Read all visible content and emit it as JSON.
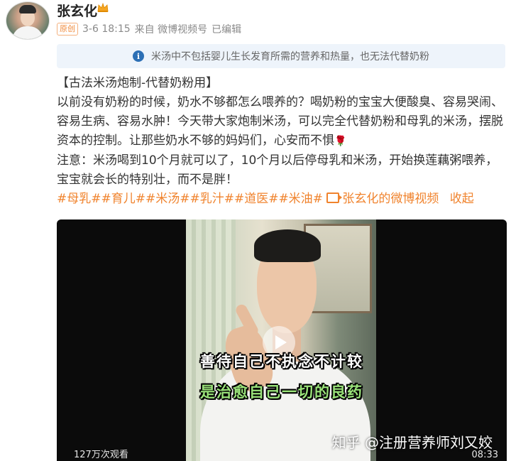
{
  "author": {
    "name": "张玄化",
    "crown_icon": "crown-icon"
  },
  "meta": {
    "badge": "原创",
    "date": "3-6 18:15",
    "source": "来自 微博视频号",
    "edited": "已编辑"
  },
  "notice": {
    "icon": "info-icon",
    "text": "米汤中不包括婴儿生长发育所需的营养和热量，也无法代替奶粉"
  },
  "post": {
    "title": "【古法米汤炮制-代替奶粉用】",
    "paragraph1": "以前没有奶粉的时候，奶水不够都怎么喂养的？喝奶粉的宝宝大便酸臭、容易哭闹、容易生病、容易水肿！今天带大家炮制米汤，可以完全代替奶粉和母乳的米汤，摆脱资本的控制。让那些奶水不够的妈妈们，心安而不惧",
    "rose_emoji": "🌹",
    "paragraph2": "注意：米汤喝到10个月就可以了，10个月以后停母乳和米汤，开始换莲藕粥喂养，宝宝就会长的特别壮，而不是胖！",
    "tags": "#母乳##育儿##米汤##乳汁##道医##米油#",
    "video_link": "张玄化的微博视频",
    "collapse": "收起"
  },
  "video": {
    "subtitle_line1": "善待自己不执念不计较",
    "subtitle_line2": "是治愈自己一切的良药",
    "views": "127万次观看",
    "duration": "08:33",
    "watermark": "知乎 @注册营养师刘又姣"
  }
}
